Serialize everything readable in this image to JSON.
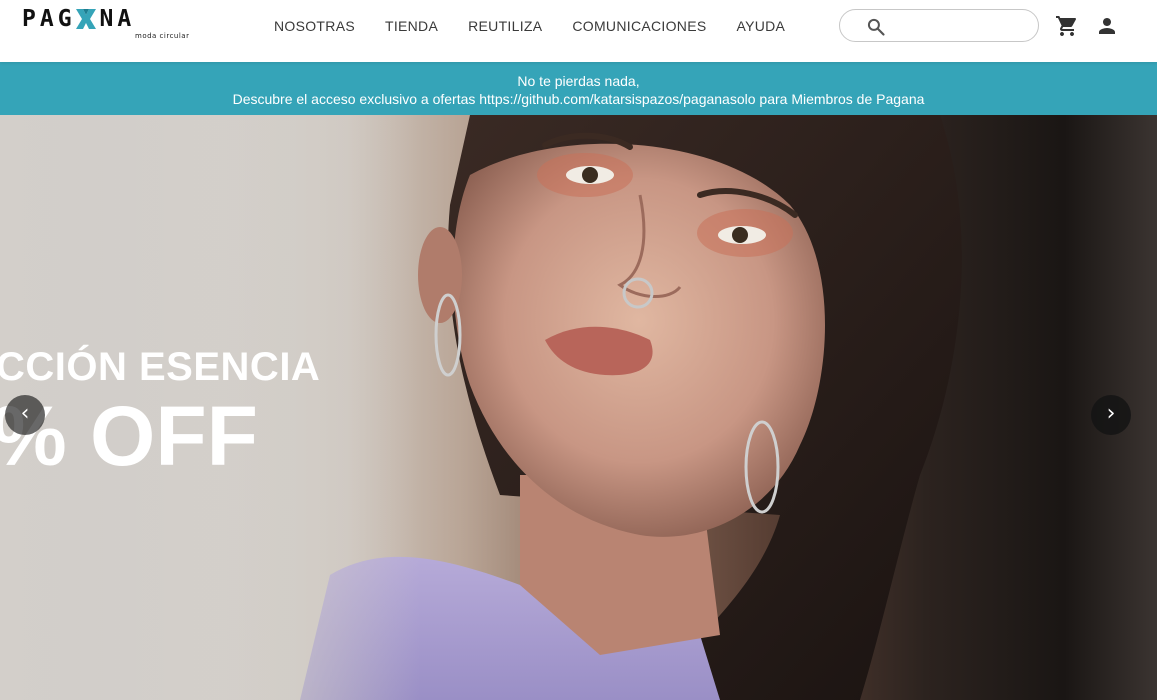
{
  "brand": {
    "logo_text_left": "PAG",
    "logo_text_right": "NA",
    "tagline": "moda circular",
    "accent_color": "#35a4b8"
  },
  "nav": {
    "items": [
      {
        "label": "NOSOTRAS"
      },
      {
        "label": "TIENDA"
      },
      {
        "label": "REUTILIZA"
      },
      {
        "label": "COMUNICACIONES"
      },
      {
        "label": "AYUDA"
      }
    ]
  },
  "search": {
    "value": "",
    "placeholder": "",
    "icon": "search-icon"
  },
  "header_icons": {
    "cart": "cart-icon",
    "account": "account-icon"
  },
  "promo": {
    "line1": "No te pierdas nada,",
    "line2": "Descubre el acceso exclusivo a ofertas https://github.com/katarsispazos/paganasolo para Miembros de Pagana",
    "background": "#35a4b8"
  },
  "hero": {
    "title": "CCIÓN ESENCIA",
    "discount": "% OFF",
    "prev_label": "‹",
    "next_label": "›"
  }
}
